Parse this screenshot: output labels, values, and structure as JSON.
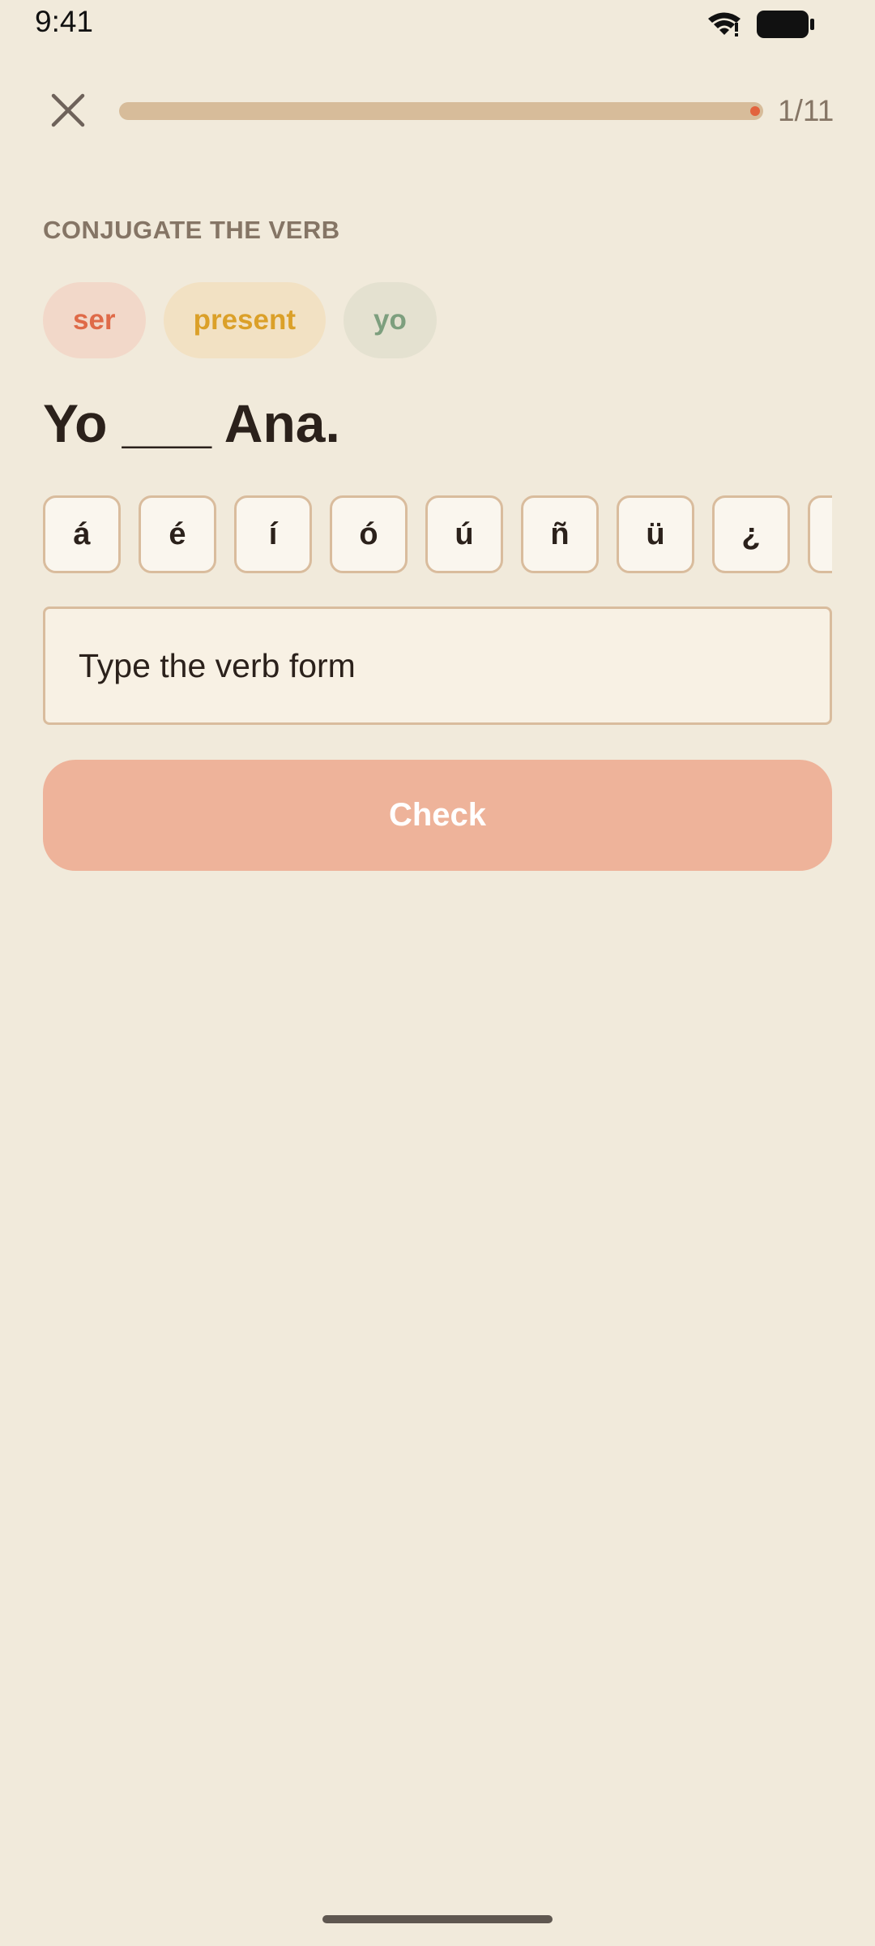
{
  "status_bar": {
    "time": "9:41",
    "icons": [
      "wifi-icon",
      "battery-icon"
    ]
  },
  "header": {
    "close_icon": "close-icon",
    "progress_text": "1/11",
    "progress_value": 0.09
  },
  "prompt": {
    "instruction": "CONJUGATE THE VERB",
    "chips": {
      "verb": "ser",
      "tense": "present",
      "person": "yo"
    },
    "sentence": "Yo ___ Ana."
  },
  "accent_keys": [
    "á",
    "é",
    "í",
    "ó",
    "ú",
    "ñ",
    "ü",
    "¿",
    "¡"
  ],
  "answer": {
    "value": "",
    "placeholder": "Type the verb form"
  },
  "check_button": {
    "label": "Check"
  },
  "colors": {
    "background": "#F1EADB",
    "accent": "#EEB39A",
    "progress_track": "#D7BC9A",
    "progress_dot": "#E2633E",
    "chip_verb": "#DF6A48",
    "chip_tense": "#DBA029",
    "chip_person": "#7D9F7E"
  }
}
